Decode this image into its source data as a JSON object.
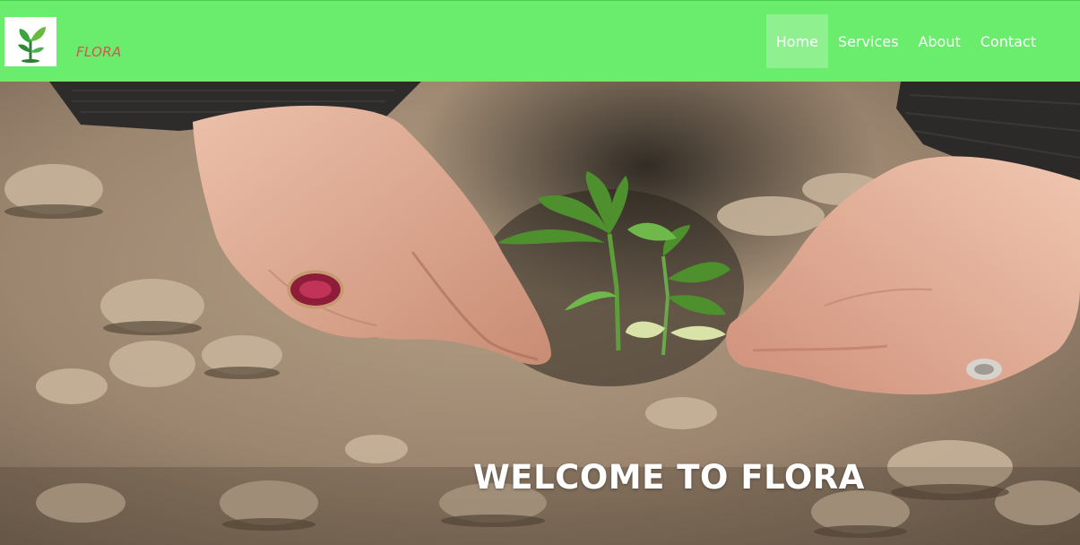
{
  "brand": {
    "logo_icon": "sprout-icon",
    "name": "FLORA",
    "name_color": "#d9534f"
  },
  "nav": {
    "background": "#6aec6c",
    "active_background": "#8ef08f",
    "items": [
      {
        "label": "Home",
        "active": true
      },
      {
        "label": "Services",
        "active": false
      },
      {
        "label": "About",
        "active": false
      },
      {
        "label": "Contact",
        "active": false
      }
    ]
  },
  "hero": {
    "image": "hands-planting-seedling-photo",
    "title": "WELCOME TO FLORA"
  }
}
